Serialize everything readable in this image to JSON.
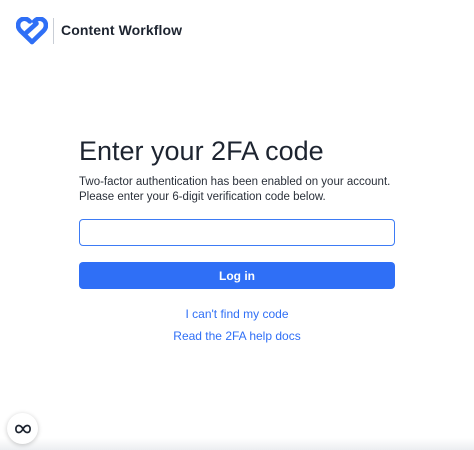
{
  "brand": {
    "name": "Content Workflow",
    "logo_icon": "heart-link-logo-icon",
    "accent_color": "#2f6ff6"
  },
  "main": {
    "title": "Enter your 2FA code",
    "description_line1": "Two-factor authentication has been enabled on your account.",
    "description_line2": "Please enter your 6-digit verification code below.",
    "code_input": {
      "value": "",
      "placeholder": ""
    },
    "login_button_label": "Log in",
    "cant_find_link": "I can't find my code",
    "help_docs_link": "Read the 2FA help docs"
  },
  "floating_button": {
    "icon": "infinity-loop-icon"
  }
}
